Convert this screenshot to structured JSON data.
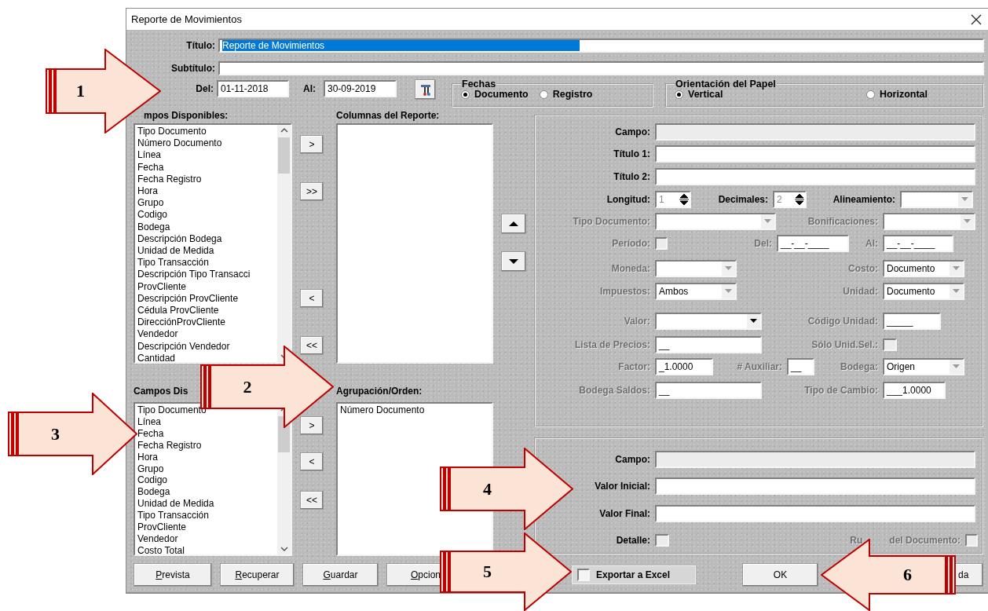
{
  "window": {
    "title": "Reporte de Movimientos"
  },
  "title_field": {
    "label": "Título:",
    "value": "Reporte de Movimientos",
    "selected": true
  },
  "subtitle_field": {
    "label": "Subtítulo:"
  },
  "date_range": {
    "from_label": "Del:",
    "from_value": "01-11-2018",
    "to_label": "Al:",
    "to_value": "30-09-2019"
  },
  "date_type": {
    "title": "Fechas",
    "options": [
      {
        "label": "Documento",
        "selected": true
      },
      {
        "label": "Registro",
        "selected": false
      }
    ]
  },
  "orientation": {
    "title": "Orientación del Papel",
    "options": [
      {
        "label": "Vertical",
        "selected": true
      },
      {
        "label": "Horizontal",
        "selected": false
      }
    ]
  },
  "available_fields": {
    "label": "mpos Disponibles:",
    "items": [
      {
        "text": "Tipo Documento",
        "selected": false
      },
      {
        "text": "Número Documento",
        "selected": false
      },
      {
        "text": "Línea",
        "selected": false
      },
      {
        "text": "Fecha",
        "selected": false
      },
      {
        "text": "Fecha Registro",
        "selected": false
      },
      {
        "text": "Hora",
        "selected": false
      },
      {
        "text": "Grupo",
        "selected": false
      },
      {
        "text": "Codigo",
        "selected": false
      },
      {
        "text": "Bodega",
        "selected": false
      },
      {
        "text": "Descripción Bodega",
        "selected": false
      },
      {
        "text": "Unidad de Medida",
        "selected": false
      },
      {
        "text": "Tipo Transacción",
        "selected": false
      },
      {
        "text": "Descripción Tipo Transacci",
        "selected": false
      },
      {
        "text": "ProvCliente",
        "selected": false
      },
      {
        "text": "Descripción ProvCliente",
        "selected": false
      },
      {
        "text": "Cédula ProvCliente",
        "selected": false
      },
      {
        "text": "DirecciónProvCliente",
        "selected": false
      },
      {
        "text": "Vendedor",
        "selected": false
      },
      {
        "text": "Descripción Vendedor",
        "selected": false
      },
      {
        "text": "Cantidad",
        "selected": false
      }
    ]
  },
  "column_transfer_buttons": [
    ">",
    ">>",
    "<",
    "<<"
  ],
  "report_columns": {
    "label": "Columnas del Reporte:"
  },
  "column_properties": {
    "rows": [
      {
        "controls": [
          {
            "kind": "display",
            "label": "Campo:",
            "disabled": false
          }
        ]
      },
      {
        "controls": [
          {
            "kind": "text",
            "label": "Título 1:",
            "disabled": false
          }
        ]
      },
      {
        "controls": [
          {
            "kind": "text",
            "label": "Título 2:",
            "disabled": false
          }
        ]
      },
      {
        "controls": [
          {
            "kind": "spin",
            "label": "Longitud:",
            "value": "1",
            "disabled": false
          },
          {
            "kind": "spin",
            "label": "Decimales:",
            "value": "2",
            "disabled": false
          },
          {
            "kind": "select",
            "label": "Alineamiento:",
            "disabled": false,
            "arrow_active": false
          }
        ]
      },
      {
        "controls": [
          {
            "kind": "select",
            "label": "Tipo Documento:",
            "disabled": true,
            "arrow_active": false
          },
          {
            "kind": "select",
            "label": "Bonificaciones:",
            "disabled": true,
            "arrow_active": false
          }
        ]
      },
      {
        "controls": [
          {
            "kind": "check",
            "label": "Período:",
            "disabled": true,
            "checked": false
          },
          {
            "kind": "text",
            "label": "Del:",
            "value": "__-__-____",
            "disabled": true
          },
          {
            "kind": "text",
            "label": "Al:",
            "value": "__-__-____",
            "disabled": true
          }
        ]
      },
      {
        "controls": [
          {
            "kind": "select",
            "label": "Moneda:",
            "disabled": true,
            "arrow_active": false
          },
          {
            "kind": "select",
            "label": "Costo:",
            "value": "Documento",
            "disabled": true,
            "arrow_active": false
          }
        ]
      },
      {
        "controls": [
          {
            "kind": "select",
            "label": "Impuestos:",
            "value": "Ambos",
            "disabled": true,
            "arrow_active": false
          },
          {
            "kind": "select",
            "label": "Unidad:",
            "value": "Documento",
            "disabled": true,
            "arrow_active": false
          }
        ]
      },
      {
        "controls": [
          {
            "kind": "select",
            "label": "Valor:",
            "disabled": true,
            "arrow_active": true
          },
          {
            "kind": "text",
            "label": "Código Unidad:",
            "value": "_____",
            "disabled": true
          }
        ]
      },
      {
        "controls": [
          {
            "kind": "text",
            "label": "Lista de Precios:",
            "value": "__",
            "disabled": true
          },
          {
            "kind": "check",
            "label": "Sólo Unid.Sel.:",
            "disabled": true,
            "checked": false
          }
        ]
      },
      {
        "controls": [
          {
            "kind": "text",
            "label": "Factor:",
            "value": "_1.0000",
            "disabled": true
          },
          {
            "kind": "text",
            "label": "# Auxiliar:",
            "value": "__",
            "disabled": true
          },
          {
            "kind": "select",
            "label": "Bodega:",
            "value": "Origen",
            "disabled": true,
            "arrow_active": false
          }
        ]
      },
      {
        "controls": [
          {
            "kind": "text",
            "label": "Bodega Saldos:",
            "value": "__",
            "disabled": true
          },
          {
            "kind": "text",
            "label": "Tipo de Cambio:",
            "value": "___1.0000",
            "disabled": true
          }
        ]
      }
    ]
  },
  "grouping_fields": {
    "label": "Campos Dis",
    "items": [
      {
        "text": "Tipo Documento",
        "selected": false
      },
      {
        "text": "Línea",
        "selected": false
      },
      {
        "text": "Fecha",
        "selected": false
      },
      {
        "text": "Fecha Registro",
        "selected": false
      },
      {
        "text": "Hora",
        "selected": false
      },
      {
        "text": "Grupo",
        "selected": false
      },
      {
        "text": "Codigo",
        "selected": false
      },
      {
        "text": "Bodega",
        "selected": false
      },
      {
        "text": "Unidad de Medida",
        "selected": false
      },
      {
        "text": "Tipo Transacción",
        "selected": false
      },
      {
        "text": "ProvCliente",
        "selected": false
      },
      {
        "text": "Vendedor",
        "selected": false
      },
      {
        "text": "Costo Total",
        "selected": false
      }
    ]
  },
  "grouping_transfer_buttons": [
    ">",
    "<",
    "<<"
  ],
  "grouping_order": {
    "label": "Agrupación/Orden:",
    "items": [
      {
        "text": "Número Documento",
        "selected": false
      }
    ]
  },
  "filter": {
    "rows": [
      {
        "controls": [
          {
            "kind": "display",
            "label": "Campo:",
            "disabled": false
          }
        ]
      },
      {
        "controls": [
          {
            "kind": "text",
            "label": "Valor Inicial:",
            "disabled": false
          }
        ]
      },
      {
        "controls": [
          {
            "kind": "text",
            "label": "Valor Final:",
            "disabled": false
          }
        ]
      },
      {
        "controls": [
          {
            "kind": "check",
            "label": "Detalle:",
            "disabled": false,
            "checked": false
          },
          {
            "kind": "check",
            "label": [
              "Ru",
              "del Documento:"
            ],
            "disabled": true,
            "checked": false
          }
        ]
      }
    ]
  },
  "action_buttons": [
    {
      "label": "Prevista",
      "underline_first": true
    },
    {
      "label": "Recuperar",
      "underline_first": true
    },
    {
      "label": "Guardar",
      "underline_first": true
    },
    {
      "label": "Opcion",
      "underline_first": true
    }
  ],
  "export_excel": {
    "label": "Exportar a Excel",
    "checked": false
  },
  "dialog_buttons": [
    {
      "label": "OK"
    },
    {
      "label": "da"
    }
  ],
  "callouts": [
    {
      "number": "1",
      "kind": "right"
    },
    {
      "number": "2",
      "kind": "right"
    },
    {
      "number": "3",
      "kind": "right"
    },
    {
      "number": "4",
      "kind": "right"
    },
    {
      "number": "5",
      "kind": "right"
    },
    {
      "number": "6",
      "kind": "left"
    }
  ]
}
